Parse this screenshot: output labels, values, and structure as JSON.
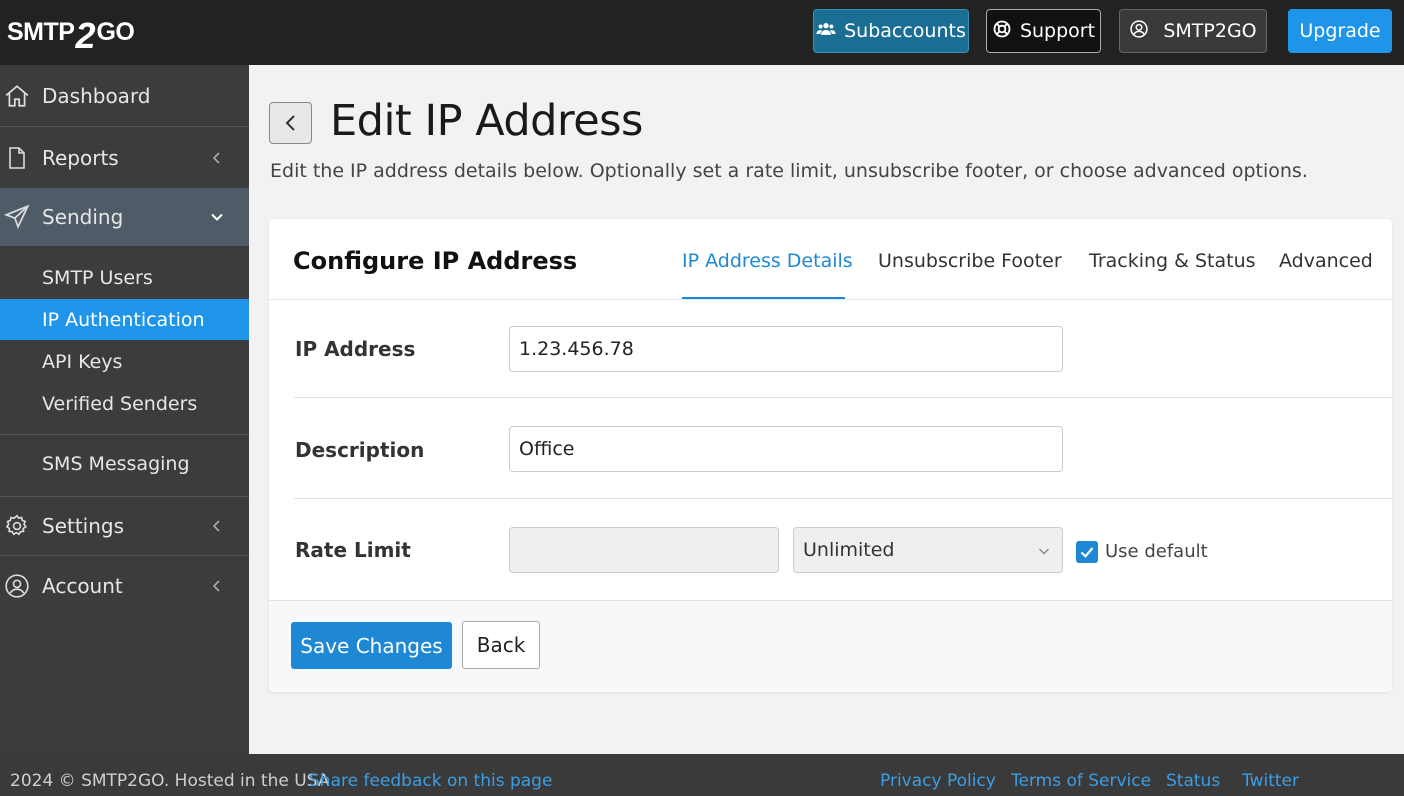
{
  "header": {
    "logo_prefix": "SMTP",
    "logo_two": "2",
    "logo_suffix": "GO",
    "subaccounts_label": "Subaccounts",
    "support_label": "Support",
    "account_label": "SMTP2GO",
    "upgrade_label": "Upgrade"
  },
  "sidebar": {
    "dashboard": "Dashboard",
    "reports": "Reports",
    "sending": "Sending",
    "sending_items": [
      "SMTP Users",
      "IP Authentication",
      "API Keys",
      "Verified Senders"
    ],
    "sms": "SMS Messaging",
    "settings": "Settings",
    "account": "Account"
  },
  "page": {
    "title": "Edit IP Address",
    "description": "Edit the IP address details below. Optionally set a rate limit, unsubscribe footer, or choose advanced options."
  },
  "card": {
    "title": "Configure IP Address",
    "tabs": [
      "IP Address Details",
      "Unsubscribe Footer",
      "Tracking & Status",
      "Advanced"
    ],
    "fields": {
      "ip_label": "IP Address",
      "ip_value": "1.23.456.78",
      "desc_label": "Description",
      "desc_value": "Office",
      "rate_label": "Rate Limit",
      "rate_value": "",
      "rate_unit": "Unlimited",
      "use_default_label": "Use default",
      "use_default_checked": true
    },
    "save_label": "Save Changes",
    "back_label": "Back"
  },
  "footer": {
    "copyright": "2024 © SMTP2GO. Hosted in the USA",
    "feedback": "Share feedback on this page",
    "links": [
      "Privacy Policy",
      "Terms of Service",
      "Status",
      "Twitter"
    ]
  },
  "colors": {
    "accent": "#1e95e8",
    "topbar": "#222222",
    "sidebar": "#3c3c3c",
    "sidebar_active_section": "#4f5b66"
  }
}
